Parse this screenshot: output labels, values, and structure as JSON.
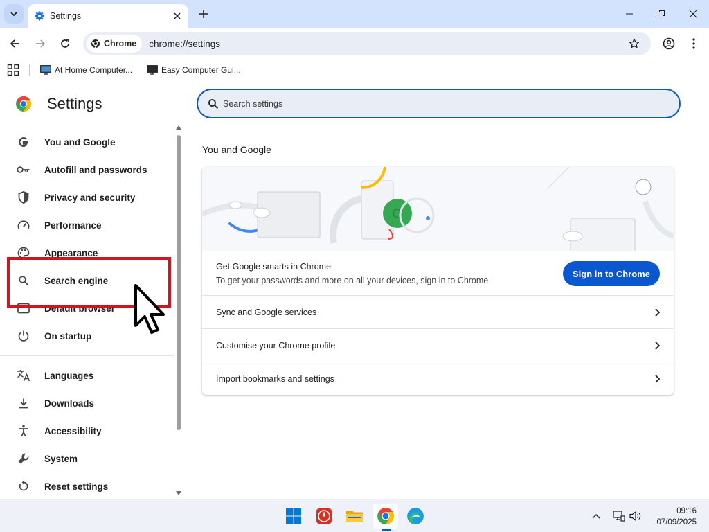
{
  "tab": {
    "title": "Settings"
  },
  "toolbar": {
    "chip_label": "Chrome",
    "url": "chrome://settings"
  },
  "bookmarks": [
    {
      "label": "At Home Computer..."
    },
    {
      "label": "Easy Computer Gui..."
    }
  ],
  "sidebar": {
    "title": "Settings",
    "items": [
      {
        "label": "You and Google",
        "icon": "google-g-icon"
      },
      {
        "label": "Autofill and passwords",
        "icon": "key-icon"
      },
      {
        "label": "Privacy and security",
        "icon": "shield-icon"
      },
      {
        "label": "Performance",
        "icon": "speedometer-icon"
      },
      {
        "label": "Appearance",
        "icon": "palette-icon"
      },
      {
        "label": "Search engine",
        "icon": "search-icon"
      },
      {
        "label": "Default browser",
        "icon": "browser-window-icon"
      },
      {
        "label": "On startup",
        "icon": "power-icon"
      },
      {
        "label": "Languages",
        "icon": "translate-icon"
      },
      {
        "label": "Downloads",
        "icon": "download-icon"
      },
      {
        "label": "Accessibility",
        "icon": "accessibility-icon"
      },
      {
        "label": "System",
        "icon": "wrench-icon"
      },
      {
        "label": "Reset settings",
        "icon": "reset-icon"
      }
    ]
  },
  "main": {
    "search_placeholder": "Search settings",
    "section_title": "You and Google",
    "signin": {
      "title": "Get Google smarts in Chrome",
      "description": "To get your passwords and more on all your devices, sign in to Chrome",
      "button": "Sign in to Chrome"
    },
    "rows": [
      {
        "label": "Sync and Google services"
      },
      {
        "label": "Customise your Chrome profile"
      },
      {
        "label": "Import bookmarks and settings"
      }
    ]
  },
  "taskbar": {
    "time": "09:16",
    "date": "07/09/2025"
  },
  "colors": {
    "accent": "#0b57d0",
    "highlight": "#d4141c",
    "tabstrip": "#d3e3fd",
    "omnibox": "#e9eef6"
  }
}
